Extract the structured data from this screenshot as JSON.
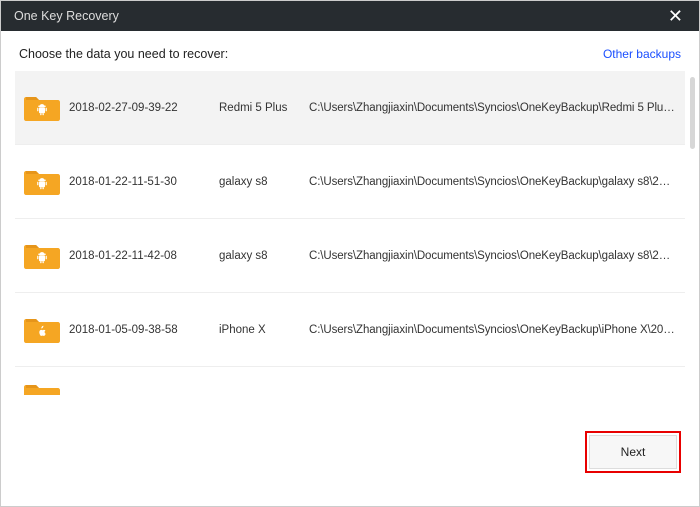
{
  "titlebar": {
    "title": "One Key Recovery"
  },
  "header": {
    "prompt": "Choose the data you need to recover:",
    "other_backups": "Other backups"
  },
  "backups": [
    {
      "date": "2018-02-27-09-39-22",
      "device": "Redmi 5 Plus",
      "path": "C:\\Users\\Zhangjiaxin\\Documents\\Syncios\\OneKeyBackup\\Redmi 5 Plus\\2...",
      "platform": "android",
      "selected": true
    },
    {
      "date": "2018-01-22-11-51-30",
      "device": "galaxy s8",
      "path": "C:\\Users\\Zhangjiaxin\\Documents\\Syncios\\OneKeyBackup\\galaxy s8\\2018-...",
      "platform": "android",
      "selected": false
    },
    {
      "date": "2018-01-22-11-42-08",
      "device": "galaxy s8",
      "path": "C:\\Users\\Zhangjiaxin\\Documents\\Syncios\\OneKeyBackup\\galaxy s8\\2018-...",
      "platform": "android",
      "selected": false
    },
    {
      "date": "2018-01-05-09-38-58",
      "device": "iPhone X",
      "path": "C:\\Users\\Zhangjiaxin\\Documents\\Syncios\\OneKeyBackup\\iPhone X\\2018-...",
      "platform": "apple",
      "selected": false
    }
  ],
  "footer": {
    "next_label": "Next"
  }
}
